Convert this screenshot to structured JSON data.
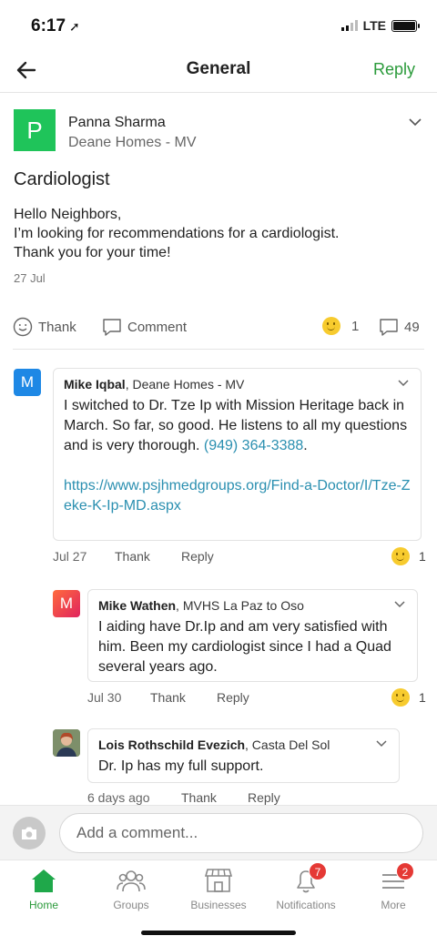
{
  "status_bar": {
    "time": "6:17",
    "network": "LTE"
  },
  "header": {
    "title": "General",
    "reply_label": "Reply"
  },
  "post": {
    "avatar_letter": "P",
    "author": "Panna Sharma",
    "neighborhood": "Deane Homes - MV",
    "title": "Cardiologist",
    "body": "Hello Neighbors,\nI’m looking for recommendations for a cardiologist.\nThank you for your time!",
    "date": "27 Jul",
    "thank_label": "Thank",
    "comment_label": "Comment",
    "reaction_count": "1",
    "comment_count": "49"
  },
  "comments": [
    {
      "avatar_letter": "M",
      "avatar_color": "#1e88e5",
      "author": "Mike Iqbal",
      "neighborhood": ", Deane Homes - MV",
      "text": "I switched to Dr. Tze Ip with Mission Heritage back in March. So far, so good. He listens to all my questions and is very thorough. ",
      "phone": "(949) 364-3388",
      "after_phone": ".",
      "url": "https://www.psjhmedgroups.org/Find-a-Doctor/I/Tze-Zeke-K-Ip-MD.aspx",
      "date": "Jul 27",
      "thank_label": "Thank",
      "reply_label": "Reply",
      "reactions": "1"
    },
    {
      "avatar_letter": "M",
      "avatar_color": "#e8445a",
      "author": "Mike Wathen",
      "neighborhood": ", MVHS La Paz to Oso",
      "text": "I aiding have Dr.Ip and am very satisfied with him. Been my cardiologist since I had a Quad several years ago.",
      "date": "Jul 30",
      "thank_label": "Thank",
      "reply_label": "Reply",
      "reactions": "1"
    },
    {
      "author": "Lois Rothschild Evezich",
      "neighborhood": ", Casta Del Sol",
      "text": "Dr. Ip has my full support.",
      "date": "6 days ago",
      "thank_label": "Thank",
      "reply_label": "Reply"
    }
  ],
  "composer": {
    "placeholder": "Add a comment..."
  },
  "tabs": [
    {
      "label": "Home",
      "icon": "home-icon",
      "active": true
    },
    {
      "label": "Groups",
      "icon": "groups-icon"
    },
    {
      "label": "Businesses",
      "icon": "storefront-icon"
    },
    {
      "label": "Notifications",
      "icon": "bell-icon",
      "badge": "7"
    },
    {
      "label": "More",
      "icon": "menu-icon",
      "badge": "2"
    }
  ],
  "colors": {
    "brand_green": "#2a9a3a",
    "link": "#2a8fb0",
    "badge_red": "#e53935"
  }
}
